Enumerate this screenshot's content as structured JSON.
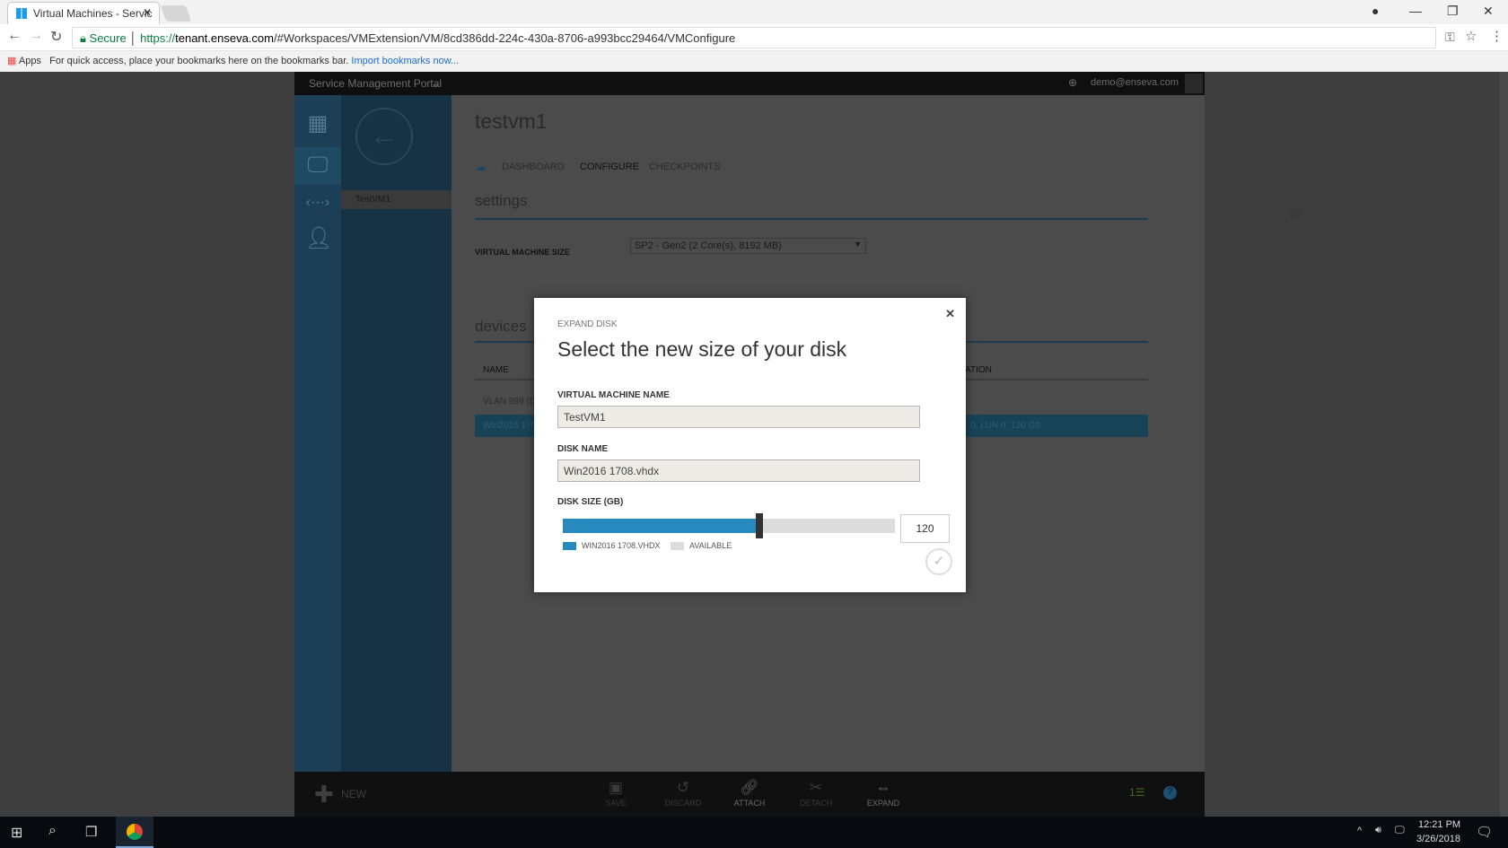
{
  "browser": {
    "tab_title": "Virtual Machines - Servic",
    "url_secure": "Secure",
    "url_scheme": "https://",
    "url_domain": "tenant.enseva.com",
    "url_path": "/#Workspaces/VMExtension/VM/8cd386dd-224c-430a-8706-a993bcc29464/VMConfigure",
    "apps_label": "Apps",
    "bookmarks_hint": "For quick access, place your bookmarks here on the bookmarks bar.",
    "import_link": "Import bookmarks now..."
  },
  "portal": {
    "title": "Service Management Portal",
    "user": "demo@enseva.com",
    "vm_list_item": "TestVM1",
    "page_title": "testvm1",
    "tabs": [
      "DASHBOARD",
      "CONFIGURE",
      "CHECKPOINTS"
    ],
    "active_tab": "CONFIGURE",
    "settings_heading": "settings",
    "vm_size_label": "VIRTUAL MACHINE SIZE",
    "vm_size_value": "SP2 - Gen2 (2 Core(s), 8192 MB)",
    "devices_heading": "devices",
    "col_name": "NAME",
    "col_location": "ATION",
    "row1_name": "VLAN 999 (D",
    "row2_name": "Win2016 170",
    "row2_location": "0, LUN 0, 120 GB"
  },
  "bottombar": {
    "new_label": "NEW",
    "buttons": [
      "SAVE",
      "DISCARD",
      "ATTACH",
      "DETACH",
      "EXPAND"
    ],
    "notification_count": "1"
  },
  "modal": {
    "eyebrow": "EXPAND DISK",
    "title": "Select the new size of your disk",
    "vm_name_label": "VIRTUAL MACHINE NAME",
    "vm_name_value": "TestVM1",
    "disk_name_label": "DISK NAME",
    "disk_name_value": "Win2016 1708.vhdx",
    "disk_size_label": "DISK SIZE (GB)",
    "disk_size_value": "120",
    "slider_fraction": 0.58,
    "legend_used": "WIN2016 1708.VHDX",
    "legend_available": "AVAILABLE",
    "colors": {
      "used": "#2789bd",
      "available": "#dcdcdc"
    }
  },
  "taskbar": {
    "time": "12:21 PM",
    "date": "3/26/2018"
  }
}
